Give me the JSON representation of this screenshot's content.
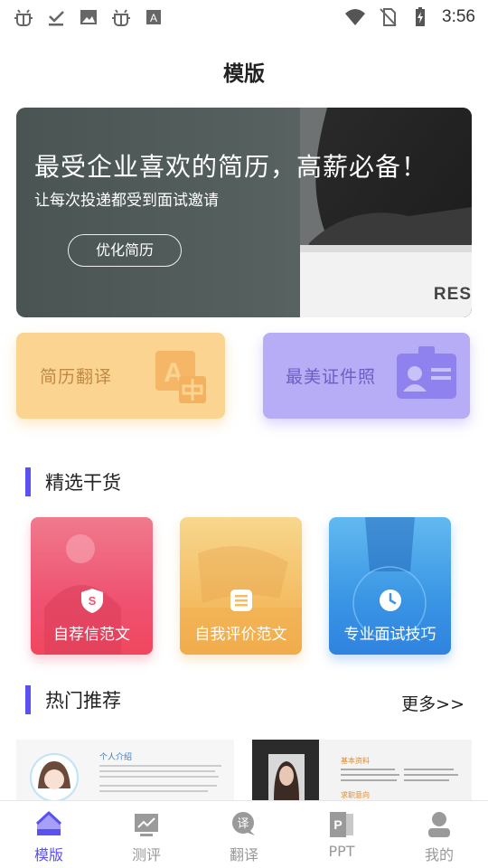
{
  "status_bar": {
    "time": "3:56",
    "left_icons": [
      "bug-icon",
      "download-done-icon",
      "image-icon",
      "bug-icon",
      "font-icon"
    ],
    "right_icons": [
      "wifi-icon",
      "no-sim-icon",
      "battery-charging-icon"
    ]
  },
  "header": {
    "title": "模版"
  },
  "banner": {
    "headline": "最受企业喜欢的简历，高薪必备！",
    "subtitle": "让每次投递都受到面试邀请",
    "button_label": "优化简历",
    "paper_text": "RES"
  },
  "features": [
    {
      "label": "简历翻译",
      "icon": "translate-icon",
      "color": "#fbd492"
    },
    {
      "label": "最美证件照",
      "icon": "id-card-icon",
      "color": "#b7acf6"
    }
  ],
  "sections": {
    "selected": {
      "title": "精选干货"
    },
    "hot": {
      "title": "热门推荐",
      "more": "更多>>"
    }
  },
  "tiles": [
    {
      "label": "自荐信范文",
      "icon": "shield-icon",
      "color": "#ef5270"
    },
    {
      "label": "自我评价范文",
      "icon": "document-icon",
      "color": "#f4bd63"
    },
    {
      "label": "专业面试技巧",
      "icon": "clock-icon",
      "color": "#3a95e4"
    }
  ],
  "previews": {
    "first": {
      "heading": "个人介绍"
    },
    "second": {
      "heading": "基本资料",
      "subheading": "求职意向"
    }
  },
  "bottom_nav": [
    {
      "label": "模版",
      "icon": "home-icon",
      "active": true
    },
    {
      "label": "测评",
      "icon": "chart-icon",
      "active": false
    },
    {
      "label": "翻译",
      "icon": "translate-bubble-icon",
      "active": false
    },
    {
      "label": "PPT",
      "icon": "ppt-icon",
      "active": false
    },
    {
      "label": "我的",
      "icon": "user-icon",
      "active": false
    }
  ],
  "colors": {
    "accent": "#5b50f0",
    "inactive": "#999999"
  }
}
